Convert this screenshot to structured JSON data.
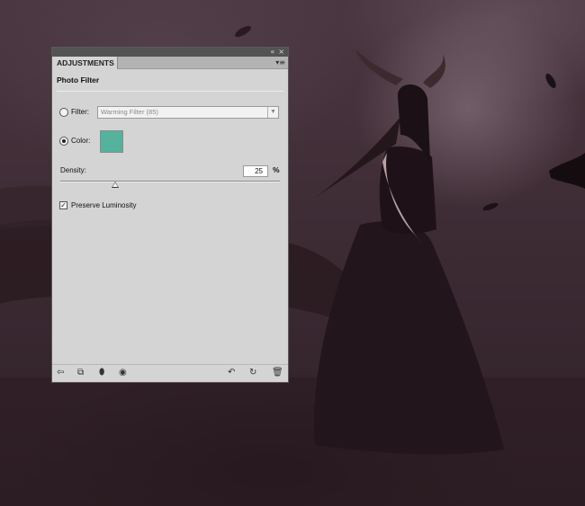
{
  "panel": {
    "tab_label": "ADJUSTMENTS",
    "title": "Photo Filter",
    "titlebar": {
      "collapse_icon": "«",
      "close_icon": "×"
    },
    "menu_icon": "▾≡",
    "filter": {
      "label": "Filter:",
      "selected": false,
      "value": "Warming Filter (85)"
    },
    "color": {
      "label": "Color:",
      "selected": true,
      "swatch": "#55b29c"
    },
    "density": {
      "label": "Density:",
      "value": "25",
      "unit": "%",
      "level_percent": 25
    },
    "preserve_luminosity": {
      "label": "Preserve Luminosity",
      "checked": true
    }
  },
  "bottom_toolbar": {
    "left": [
      "back-arrow-icon",
      "clip-to-layer-icon",
      "layer-visibility-icon",
      "eye-icon"
    ],
    "right": [
      "previous-state-icon",
      "reset-icon",
      "trash-icon"
    ]
  }
}
